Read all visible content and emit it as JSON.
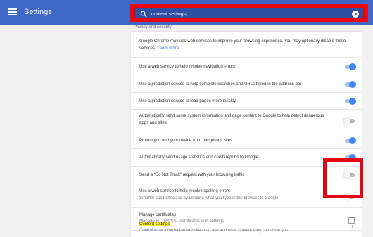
{
  "header": {
    "title": "Settings",
    "search_value": "content settings|"
  },
  "section": {
    "label": "Privacy and security"
  },
  "intro": {
    "text": "Google Chrome may use web services to improve your browsing experience. You may optionally disable these services.",
    "link": "Learn more"
  },
  "rows": [
    {
      "label": "Use a web service to help resolve navigation errors",
      "toggle": "on"
    },
    {
      "label": "Use a prediction service to help complete searches and URLs typed in the address bar",
      "toggle": "on"
    },
    {
      "label": "Use a prediction service to load pages more quickly",
      "toggle": "on"
    },
    {
      "label": "Automatically send some system information and page content to Google to help detect dangerous",
      "label2": "apps and sites",
      "toggle": "off"
    },
    {
      "label": "Protect you and your device from dangerous sites",
      "toggle": "on"
    },
    {
      "label": "Automatically send usage statistics and crash reports to Google",
      "toggle": "on"
    },
    {
      "label": "Send a \"Do Not Track\" request with your browsing traffic",
      "toggle": "off"
    },
    {
      "label": "Use a web service to help resolve spelling errors",
      "sub": "Smarter spell-checking by sending what you type in the browser to Google",
      "toggle": "off"
    }
  ],
  "certificates": {
    "label": "Manage certificates",
    "sub": "Manage HTTPS/SSL certificates and settings"
  },
  "content_settings": {
    "label": "Content settings",
    "sub": "Control what information websites can use and what content they can show you"
  },
  "colors": {
    "header": "#3e67c8",
    "toggle_on": "#4285f4",
    "highlight_box": "#e30613",
    "search_highlight": "#fff235"
  }
}
